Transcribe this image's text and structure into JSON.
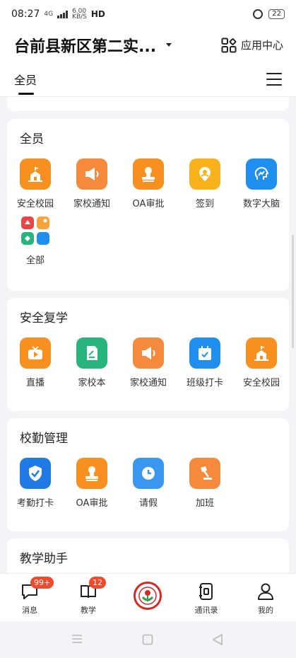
{
  "status_bar": {
    "time": "08:27",
    "network_type": "4G",
    "net_speed": "6.00",
    "net_unit": "KB/S",
    "hd": "HD",
    "battery": "22"
  },
  "header": {
    "school_name": "台前县新区第二实...",
    "app_center_label": "应用中心"
  },
  "tabs": {
    "active_label": "全员"
  },
  "sections": [
    {
      "title": "全员",
      "apps": [
        {
          "label": "安全校园",
          "icon": "school-building-icon",
          "color": "#f7901e"
        },
        {
          "label": "家校通知",
          "icon": "megaphone-icon",
          "color": "#f58a3c"
        },
        {
          "label": "OA审批",
          "icon": "stamp-icon",
          "color": "#f7901e"
        },
        {
          "label": "签到",
          "icon": "location-pin-icon",
          "color": "#f9b21c"
        },
        {
          "label": "数字大脑",
          "icon": "brain-chart-icon",
          "color": "#1f8fef"
        },
        {
          "label": "全部",
          "icon": "all-apps-icon",
          "color": "#e84545"
        }
      ]
    },
    {
      "title": "安全复学",
      "apps": [
        {
          "label": "直播",
          "icon": "live-tv-icon",
          "color": "#f7901e"
        },
        {
          "label": "家校本",
          "icon": "notebook-icon",
          "color": "#27b47e"
        },
        {
          "label": "家校通知",
          "icon": "megaphone-icon",
          "color": "#f58a3c"
        },
        {
          "label": "班级打卡",
          "icon": "calendar-check-icon",
          "color": "#1f8fef"
        },
        {
          "label": "安全校园",
          "icon": "school-building-icon",
          "color": "#f7901e"
        }
      ]
    },
    {
      "title": "校勤管理",
      "apps": [
        {
          "label": "考勤打卡",
          "icon": "shield-check-icon",
          "color": "#1f7ae6"
        },
        {
          "label": "OA审批",
          "icon": "stamp-icon",
          "color": "#f7901e"
        },
        {
          "label": "请假",
          "icon": "clock-icon",
          "color": "#3a97ef"
        },
        {
          "label": "加班",
          "icon": "desk-lamp-icon",
          "color": "#f58a3c"
        }
      ]
    },
    {
      "title": "教学助手",
      "apps": []
    }
  ],
  "bottom_nav": {
    "items": [
      {
        "label": "消息",
        "icon": "message-icon",
        "badge": "99+"
      },
      {
        "label": "教学",
        "icon": "book-icon",
        "badge": "12"
      },
      {
        "label": "",
        "icon": "school-logo-icon",
        "badge": ""
      },
      {
        "label": "通讯录",
        "icon": "contacts-icon",
        "badge": ""
      },
      {
        "label": "我的",
        "icon": "profile-icon",
        "badge": ""
      }
    ]
  }
}
